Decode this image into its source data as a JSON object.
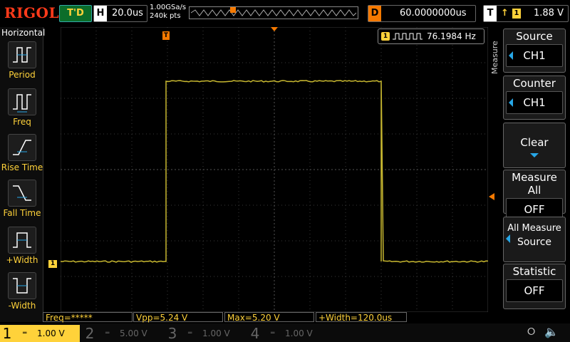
{
  "brand": "RIGOL",
  "run_state": "T'D",
  "horizontal": {
    "key": "H",
    "timebase": "20.0us"
  },
  "sample": {
    "rate": "1.00GSa/s",
    "depth": "240k pts"
  },
  "delay": {
    "key": "D",
    "value": "60.0000000us"
  },
  "trigger": {
    "key": "T",
    "source": "1",
    "level": "1.88 V"
  },
  "left_menu": {
    "title": "Horizontal",
    "items": [
      {
        "label": "Period"
      },
      {
        "label": "Freq"
      },
      {
        "label": "Rise Time"
      },
      {
        "label": "Fall Time"
      },
      {
        "label": "+Width"
      },
      {
        "label": "-Width"
      }
    ]
  },
  "frequency_readout": {
    "channel": "1",
    "value": "76.1984 Hz"
  },
  "markers": {
    "trigger_pos": "T",
    "ch1_ground": "1"
  },
  "right_menu": {
    "group": "Measure",
    "source": {
      "label": "Source",
      "value": "CH1"
    },
    "counter": {
      "label": "Counter",
      "value": "CH1"
    },
    "clear": {
      "label": "Clear"
    },
    "measure_all": {
      "label": "Measure All",
      "value": "OFF"
    },
    "all_measure_source": {
      "label": "All Measure",
      "value": "Source"
    },
    "statistic": {
      "label": "Statistic",
      "value": "OFF"
    }
  },
  "measurements": [
    "Freq=*****",
    "Vpp=5.24 V",
    "Max=5.20 V",
    "+Width=120.0us"
  ],
  "channels": [
    {
      "num": "1",
      "scale": "1.00 V",
      "color": "#ffd23a",
      "active": true
    },
    {
      "num": "2",
      "scale": "5.00 V",
      "color": "#27a7e7",
      "active": false
    },
    {
      "num": "3",
      "scale": "1.00 V",
      "color": "#d03bd0",
      "active": false
    },
    {
      "num": "4",
      "scale": "1.00 V",
      "color": "#2b59c3",
      "active": false
    }
  ],
  "colors": {
    "ch1_trace": "#c8b830",
    "accent_blue": "#27a7e7",
    "brand": "#ff3a1a"
  }
}
